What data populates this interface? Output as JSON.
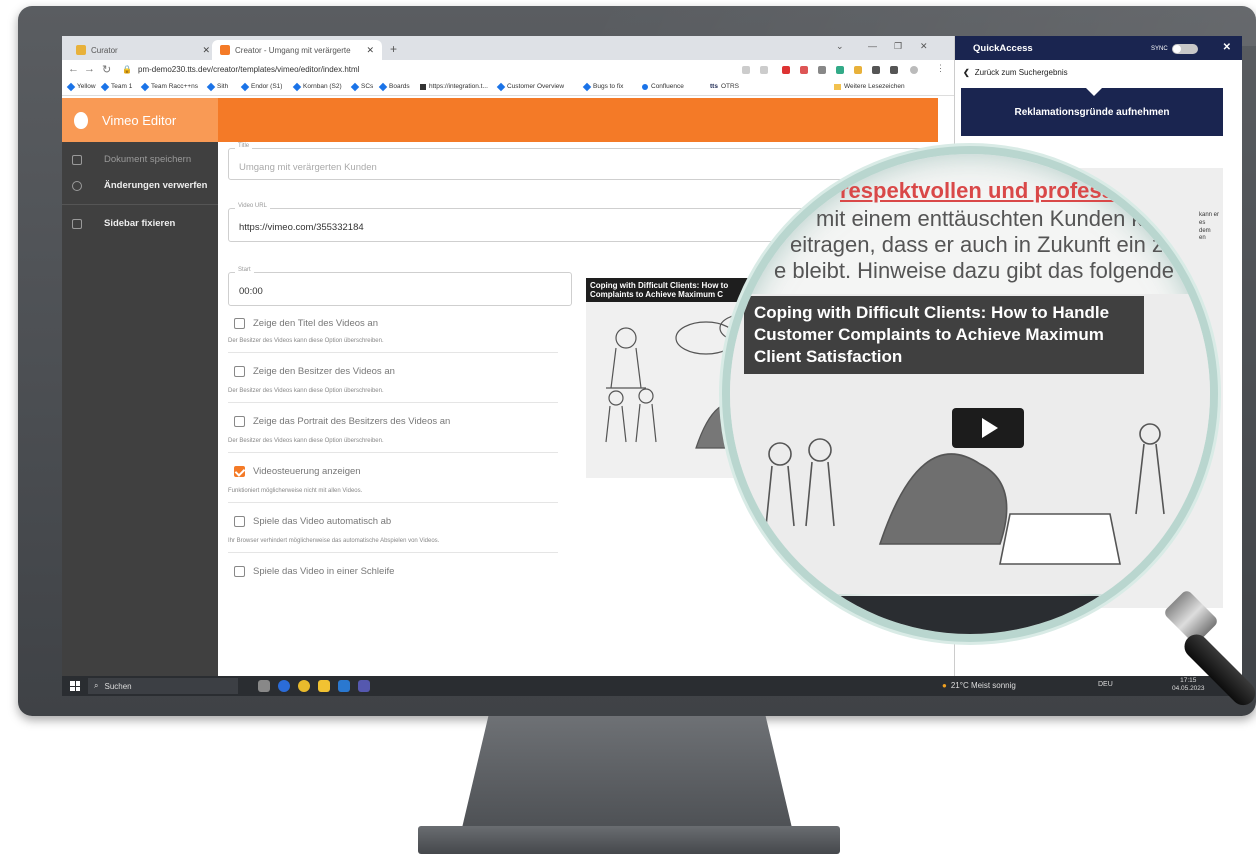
{
  "browser": {
    "tabs": [
      {
        "label": "Curator",
        "active": false
      },
      {
        "label": "Creator - Umgang mit verärgerte",
        "active": true
      }
    ],
    "url": "pm-demo230.tts.dev/creator/templates/vimeo/editor/index.html",
    "bookmarks": [
      "Yellow",
      "Team 1",
      "Team Racc++ns",
      "Sith",
      "Endor (S1)",
      "Kornban (S2)",
      "SCs",
      "Boards",
      "https://integration.t...",
      "Customer Overview",
      "Bugs to fix",
      "Confluence",
      "OTRS",
      "Weitere Lesezeichen"
    ]
  },
  "app": {
    "title": "Vimeo Editor",
    "sidebar": [
      {
        "label": "Dokument speichern"
      },
      {
        "label": "Änderungen verwerfen"
      },
      {
        "label": "Sidebar fixieren"
      }
    ],
    "form": {
      "title_label": "Title",
      "title_value": "Umgang mit verärgerten Kunden",
      "url_label": "Video URL",
      "url_value": "https://vimeo.com/355332184",
      "start_label": "Start",
      "start_value": "00:00"
    },
    "options": [
      {
        "label": "Zeige den Titel des Videos an",
        "checked": false,
        "hint": "Der Besitzer des Videos kann diese Option überschreiben."
      },
      {
        "label": "Zeige den Besitzer des Videos an",
        "checked": false,
        "hint": "Der Besitzer des Videos kann diese Option überschreiben."
      },
      {
        "label": "Zeige das Portrait des Besitzers des Videos an",
        "checked": false,
        "hint": "Der Besitzer des Videos kann diese Option überschreiben."
      },
      {
        "label": "Videosteuerung anzeigen",
        "checked": true,
        "hint": "Funktioniert möglicherweise nicht mit allen Videos."
      },
      {
        "label": "Spiele das Video automatisch ab",
        "checked": false,
        "hint": "Ihr Browser verhindert möglicherweise das automatische Abspielen von Videos."
      },
      {
        "label": "Spiele das Video in einer Schleife",
        "checked": false,
        "hint": ""
      }
    ],
    "video_title": "Coping with Difficult Clients: How to Complaints to Achieve Maximum C"
  },
  "quickaccess": {
    "title": "QuickAccess",
    "sync_label": "SYNC",
    "back_label": "Zurück zum Suchergebnis",
    "banner": "Reklamationsgründe aufnehmen",
    "side_text": [
      "kann er",
      "es",
      "dem",
      "en"
    ]
  },
  "magnifier": {
    "heading": "respektvollen und professi",
    "lines": [
      "mit einem enttäuschten Kunden kön",
      "eitragen, dass er auch in Zukunft ein zufri",
      "e bleibt. Hinweise dazu gibt das folgende Vid"
    ],
    "video_title": "Coping with Difficult Clients: How to Handle Customer Complaints to Achieve Maximum Client Satisfaction"
  },
  "taskbar": {
    "search_label": "Suchen",
    "weather": "21°C  Meist sonnig",
    "lang": "DEU",
    "time": "17:15",
    "date": "04.05.2023"
  },
  "colors": {
    "accent": "#f47a27",
    "sidebar": "#404040",
    "qa_navy": "#1a2550"
  }
}
